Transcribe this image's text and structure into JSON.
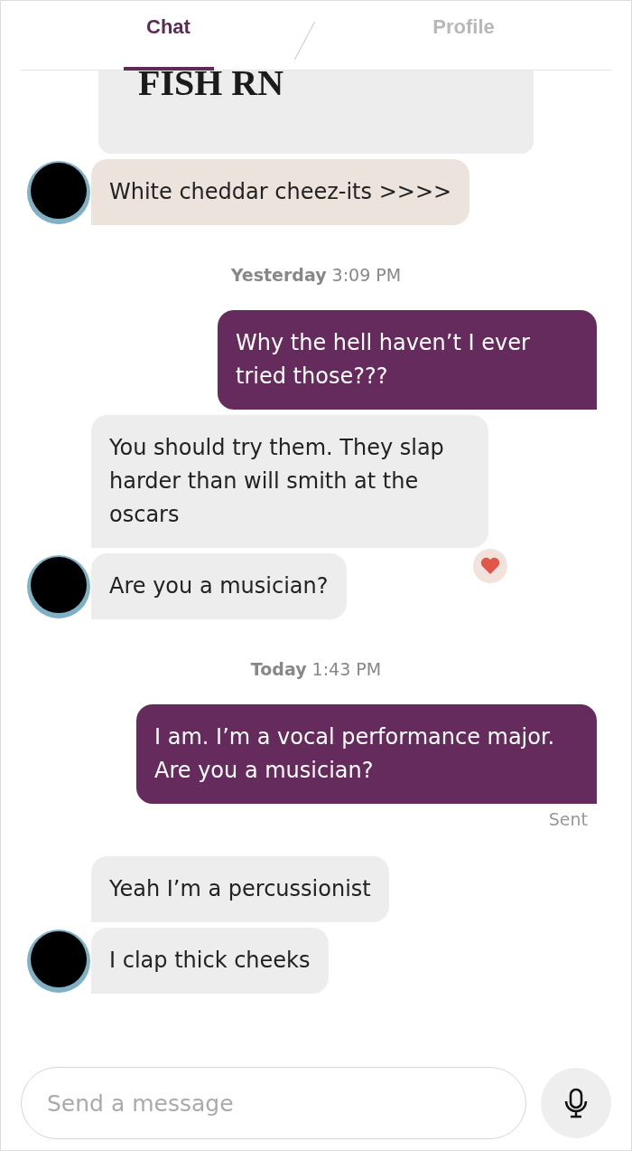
{
  "tabs": [
    {
      "label": "Chat",
      "selected": true
    },
    {
      "label": "Profile",
      "selected": false
    }
  ],
  "messages": [
    {
      "kind": "media",
      "text": "FISH RN"
    },
    {
      "kind": "received",
      "text": "White cheddar cheez-its >>>>",
      "avatar": true,
      "tinted": true,
      "liked": false
    },
    {
      "kind": "timestamp",
      "text": "**Yesterday** 3:09 PM"
    },
    {
      "kind": "sent",
      "text": "Why the hell haven’t I ever tried those???"
    },
    {
      "kind": "received",
      "text": "You should try them. They slap harder than will smith at the oscars",
      "avatar": false,
      "tinted": false,
      "liked": true
    },
    {
      "kind": "received",
      "text": "Are you a musician?",
      "avatar": true,
      "tinted": false,
      "liked": false
    },
    {
      "kind": "timestamp",
      "text": "**Today** 1:43 PM"
    },
    {
      "kind": "sent",
      "text": "I am. I’m a vocal performance major. Are you a musician?"
    },
    {
      "kind": "status",
      "text": "Sent"
    },
    {
      "kind": "received",
      "text": "Yeah I’m a percussionist",
      "avatar": false,
      "tinted": false,
      "liked": false
    },
    {
      "kind": "received",
      "text": "I clap thick cheeks",
      "avatar": true,
      "tinted": false,
      "liked": false
    }
  ],
  "composer": {
    "placeholder": "Send a message"
  }
}
